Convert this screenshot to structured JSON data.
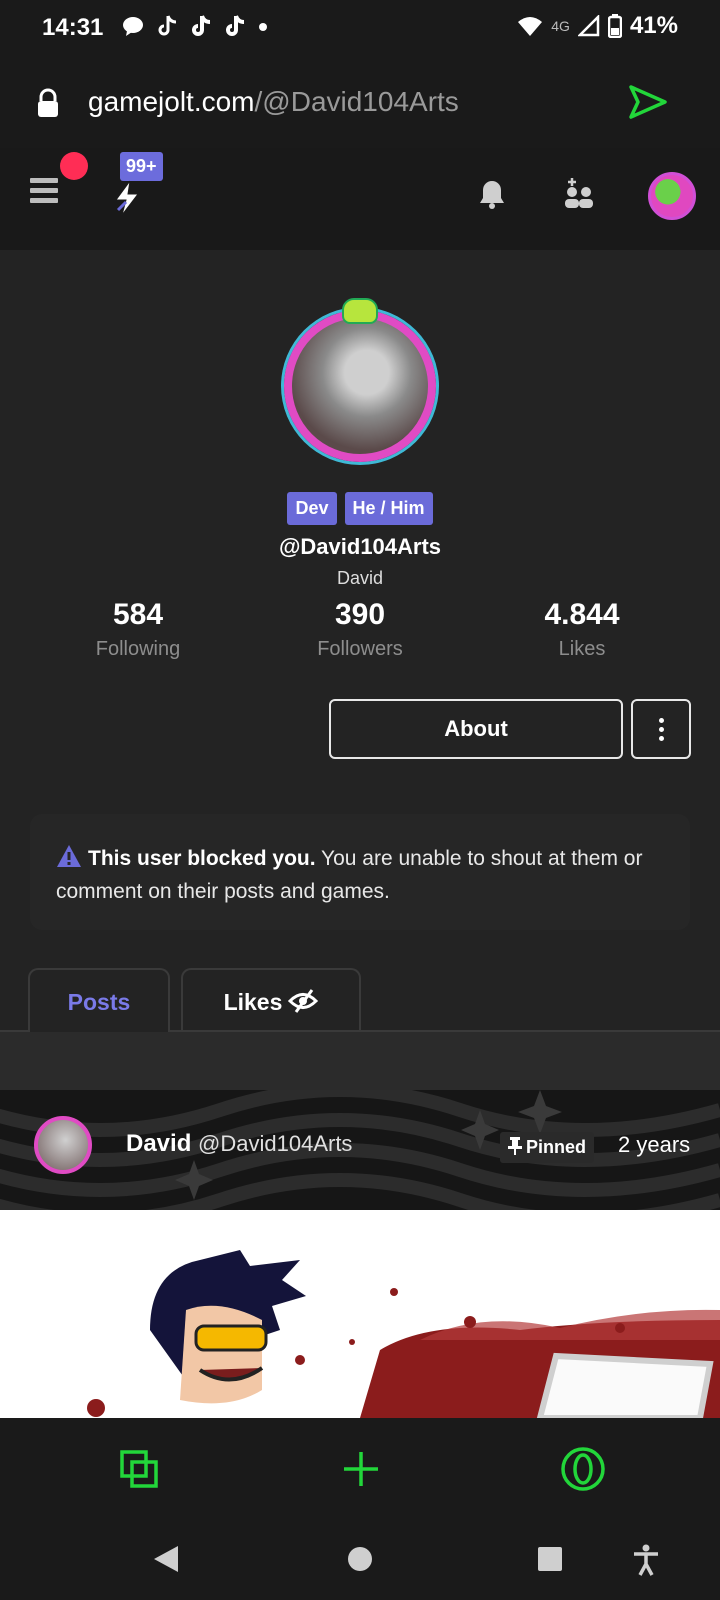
{
  "status_bar": {
    "time": "14:31",
    "network": "4G",
    "battery": "41%",
    "notification_icons": [
      "chat-bubble-icon",
      "tiktok-icon",
      "tiktok-icon",
      "tiktok-icon",
      "dot-icon"
    ]
  },
  "url_bar": {
    "host": "gamejolt.com",
    "path": "/@David104Arts"
  },
  "app_bar": {
    "badge": "99+"
  },
  "profile": {
    "tags": [
      "Dev",
      "He / Him"
    ],
    "handle": "@David104Arts",
    "display_name": "David",
    "stats": [
      {
        "value": "584",
        "label": "Following"
      },
      {
        "value": "390",
        "label": "Followers"
      },
      {
        "value": "4.844",
        "label": "Likes"
      }
    ],
    "about_label": "About"
  },
  "notice": {
    "title": "This user blocked you.",
    "body": "You are unable to shout at them or comment on their posts and games."
  },
  "tabs": [
    {
      "label": "Posts",
      "active": true
    },
    {
      "label": "Likes",
      "active": false
    }
  ],
  "post": {
    "author": "David",
    "handle": "@David104Arts",
    "pinned_label": "Pinned",
    "time_ago": "2 years"
  },
  "colors": {
    "accent": "#6b6bd9",
    "browser_green": "#22d63a",
    "alert_red": "#ff2d55"
  }
}
